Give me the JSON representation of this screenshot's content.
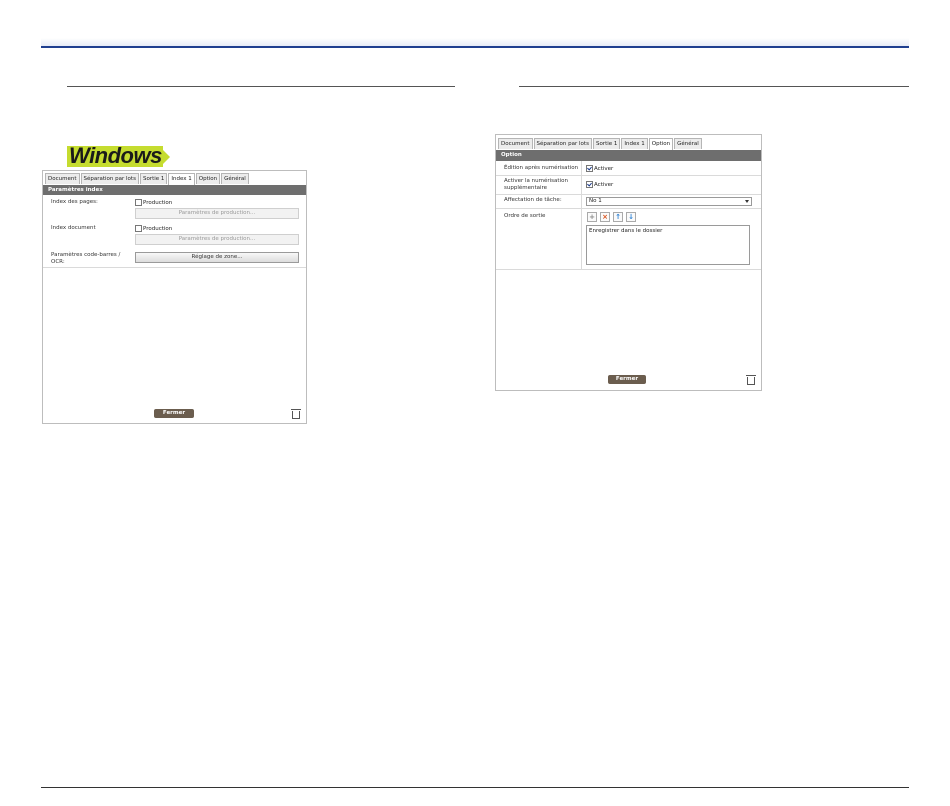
{
  "left_dialog": {
    "tabs": [
      "Document",
      "Séparation par lots",
      "Sortie 1",
      "Index 1",
      "Option",
      "Général"
    ],
    "active_tab_index": 3,
    "header": "Paramètres index",
    "page_index_label": "Index des pages:",
    "page_index_checkbox_label": "Production",
    "page_index_checked": false,
    "page_index_button": "Paramètres de production...",
    "document_index_label": "Index document",
    "document_index_checkbox_label": "Production",
    "document_index_checked": false,
    "document_index_button": "Paramètres de production...",
    "barcode_label_line1": "Paramètres code-barres /",
    "barcode_label_line2": "OCR:",
    "zone_button": "Réglage de zone...",
    "close_button": "Fermer"
  },
  "windows_badge": {
    "text": "Windows",
    "color": "#c5dc2f"
  },
  "right_dialog": {
    "tabs": [
      "Document",
      "Séparation par lots",
      "Sortie 1",
      "Index 1",
      "Option",
      "Général"
    ],
    "active_tab_index": 4,
    "header": "Option",
    "edit_after_scan_label": "Édition après numérisation",
    "edit_after_scan_checkbox": "Activer",
    "edit_after_scan_checked": true,
    "additional_scan_label_line1": "Activer la numérisation",
    "additional_scan_label_line2": "supplémentaire",
    "additional_scan_checkbox": "Activer",
    "additional_scan_checked": true,
    "job_assignment_label": "Affectation de tâche:",
    "job_assignment_value": "No 1",
    "output_order_label": "Ordre de sortie",
    "output_order_items": [
      "Enregistrer dans le dossier"
    ],
    "toolbar_icons": [
      "add-icon",
      "delete-icon",
      "move-up-icon",
      "move-down-icon"
    ],
    "close_button": "Fermer"
  },
  "colors": {
    "header_bg": "#6e6e6e",
    "close_bg": "#6b5d4e",
    "top_rule": "#1f3f8f"
  }
}
